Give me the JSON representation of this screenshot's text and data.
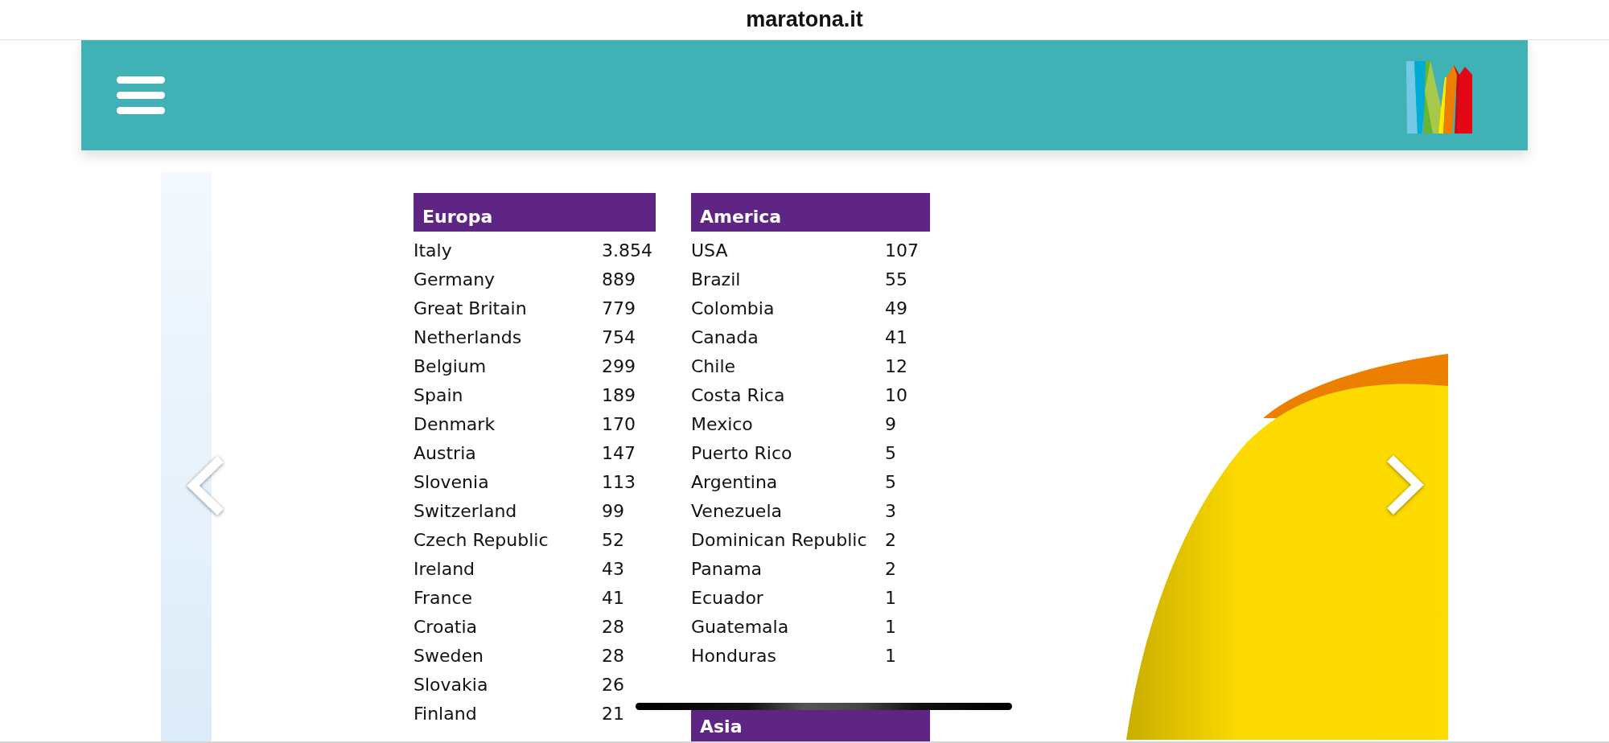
{
  "browser": {
    "address": "maratona.it"
  },
  "tables": [
    {
      "title": "Europa",
      "rows": [
        {
          "country": "Italy",
          "count": "3.854"
        },
        {
          "country": "Germany",
          "count": "889"
        },
        {
          "country": "Great Britain",
          "count": "779"
        },
        {
          "country": "Netherlands",
          "count": "754"
        },
        {
          "country": "Belgium",
          "count": "299"
        },
        {
          "country": "Spain",
          "count": "189"
        },
        {
          "country": "Denmark",
          "count": "170"
        },
        {
          "country": "Austria",
          "count": "147"
        },
        {
          "country": "Slovenia",
          "count": "113"
        },
        {
          "country": "Switzerland",
          "count": "99"
        },
        {
          "country": "Czech Republic",
          "count": "52"
        },
        {
          "country": "Ireland",
          "count": "43"
        },
        {
          "country": "France",
          "count": "41"
        },
        {
          "country": "Croatia",
          "count": "28"
        },
        {
          "country": "Sweden",
          "count": "28"
        },
        {
          "country": "Slovakia",
          "count": "26"
        },
        {
          "country": "Finland",
          "count": "21"
        }
      ]
    },
    {
      "title": "America",
      "rows": [
        {
          "country": "USA",
          "count": "107"
        },
        {
          "country": "Brazil",
          "count": "55"
        },
        {
          "country": "Colombia",
          "count": "49"
        },
        {
          "country": "Canada",
          "count": "41"
        },
        {
          "country": "Chile",
          "count": "12"
        },
        {
          "country": "Costa Rica",
          "count": "10"
        },
        {
          "country": "Mexico",
          "count": "9"
        },
        {
          "country": "Puerto Rico",
          "count": "5"
        },
        {
          "country": "Argentina",
          "count": "5"
        },
        {
          "country": "Venezuela",
          "count": "3"
        },
        {
          "country": "Dominican Republic",
          "count": "2"
        },
        {
          "country": "Panama",
          "count": "2"
        },
        {
          "country": "Ecuador",
          "count": "1"
        },
        {
          "country": "Guatemala",
          "count": "1"
        },
        {
          "country": "Honduras",
          "count": "1"
        }
      ]
    },
    {
      "title": "Asia"
    }
  ]
}
